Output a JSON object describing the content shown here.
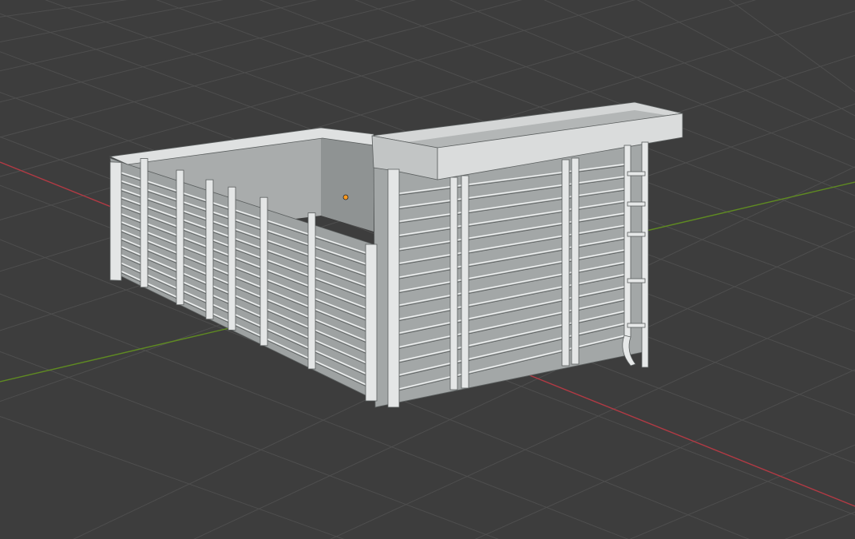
{
  "viewport": {
    "background_color": "#3d3d3d",
    "grid_color": "#4e4e4e",
    "x_axis_color": "#b23a44",
    "y_axis_color": "#5f8a22",
    "origin_marker_color": "#ff9a1f"
  },
  "model": {
    "icon": "dump-truck-bed-icon",
    "face_light": "#c9cbcb",
    "face_mid": "#9fa3a3",
    "face_dark": "#7c8080",
    "inner_wall": "#a9acac",
    "rib_highlight": "#eef0f0",
    "edge_line": "#5a5e5e"
  }
}
